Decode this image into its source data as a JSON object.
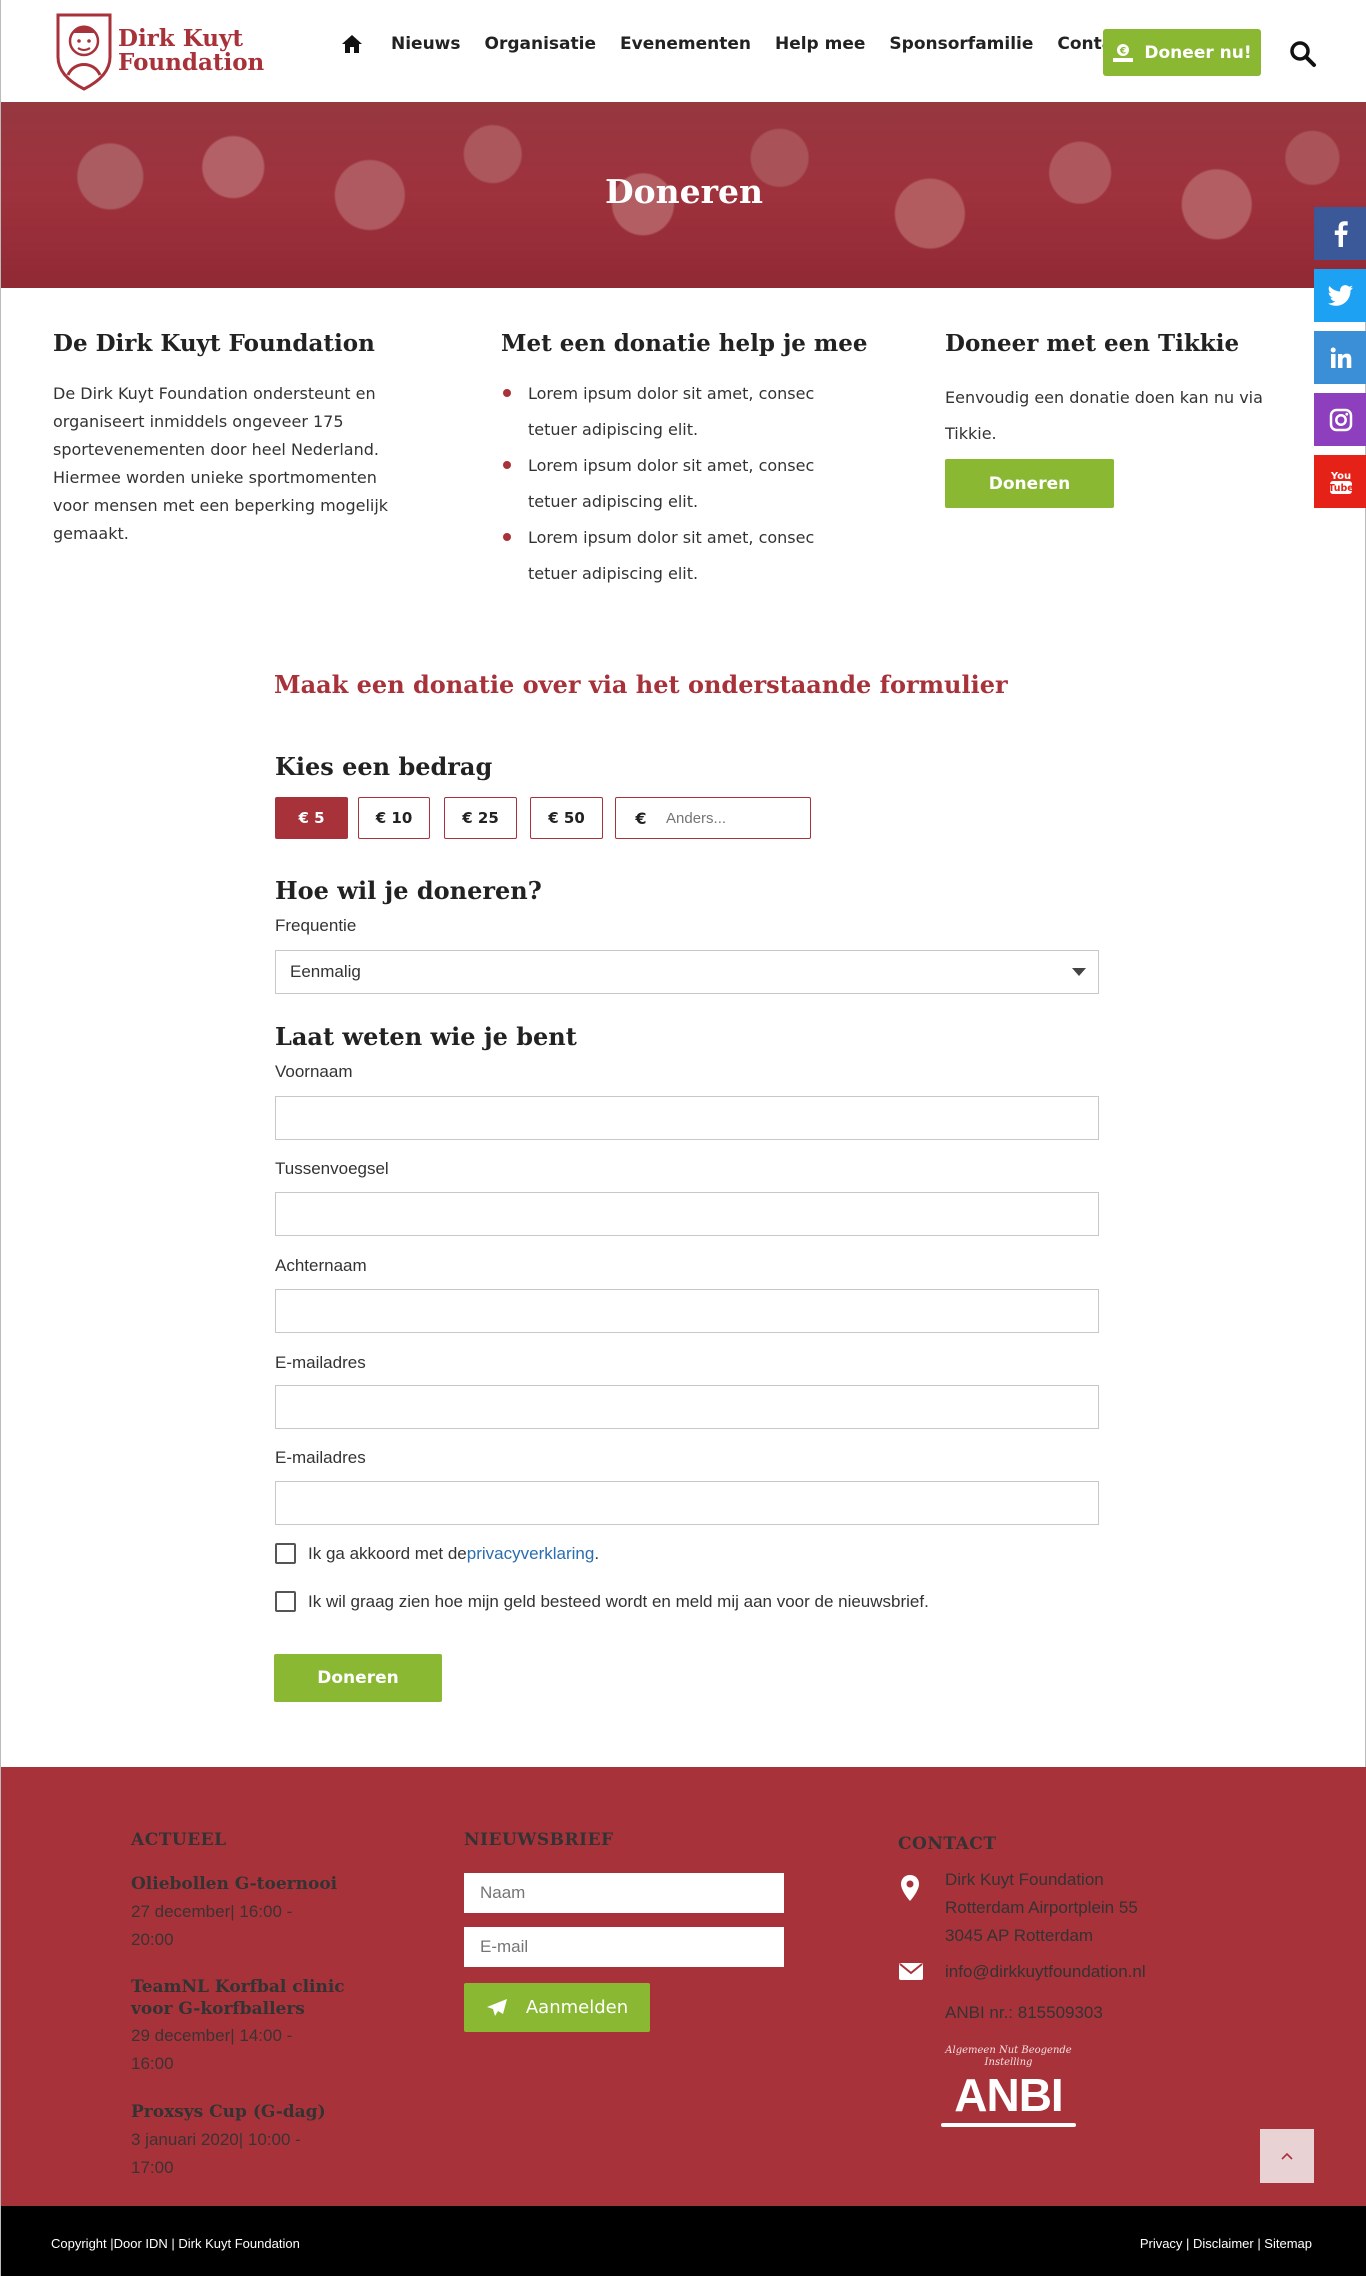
{
  "header": {
    "logo": {
      "line1": "Dirk Kuyt",
      "line2": "Foundation"
    },
    "nav": [
      "Nieuws",
      "Organisatie",
      "Evenementen",
      "Help mee",
      "Sponsorfamilie",
      "Contact"
    ],
    "donate_button": "Doneer nu!"
  },
  "hero": {
    "title": "Doneren"
  },
  "social": [
    "facebook",
    "twitter",
    "linkedin",
    "instagram",
    "youtube"
  ],
  "info": {
    "col1": {
      "title": "De Dirk Kuyt Foundation",
      "text": "De Dirk Kuyt Foundation ondersteunt en organiseert inmiddels ongeveer 175 sportevenementen door heel Nederland. Hiermee worden unieke sportmomenten voor mensen met een beperking mogelijk gemaakt."
    },
    "col2": {
      "title": "Met een donatie help je mee",
      "bullets": [
        "Lorem ipsum dolor sit amet, consec tetuer adipiscing elit.",
        "Lorem ipsum dolor sit amet, consec tetuer adipiscing elit.",
        "Lorem ipsum dolor sit amet, consec tetuer adipiscing elit."
      ]
    },
    "col3": {
      "title": "Doneer met een Tikkie",
      "text": "Eenvoudig een donatie doen kan nu via Tikkie.",
      "button": "Doneren"
    }
  },
  "form": {
    "title": "Maak een donatie over via het onderstaande formulier",
    "amount_heading": "Kies een bedrag",
    "amounts": [
      "€ 5",
      "€ 10",
      "€ 25",
      "€ 50"
    ],
    "selected_amount": "€ 5",
    "other_currency": "€",
    "other_placeholder": "Anders...",
    "how_heading": "Hoe wil je doneren?",
    "frequency_label": "Frequentie",
    "frequency_value": "Eenmalig",
    "who_heading": "Laat weten wie je bent",
    "fields": [
      "Voornaam",
      "Tussenvoegsel",
      "Achternaam",
      "E-mailadres",
      "E-mailadres"
    ],
    "privacy_prefix": "Ik ga akkoord met de ",
    "privacy_link": "privacyverklaring",
    "privacy_suffix": ".",
    "newsletter_check": "Ik wil graag zien hoe mijn geld besteed wordt en meld mij aan voor de nieuwsbrief.",
    "submit": "Doneren"
  },
  "footer": {
    "actueel": {
      "heading": "ACTUEEL",
      "events": [
        {
          "title": "Oliebollen G-toernooi",
          "date": "27 december| 16:00 - 20:00"
        },
        {
          "title": "TeamNL Korfbal clinic voor G-korfballers",
          "date": "29 december| 14:00 - 16:00"
        },
        {
          "title": "Proxsys Cup (G-dag)",
          "date": "3 januari 2020| 10:00 - 17:00"
        }
      ]
    },
    "newsletter": {
      "heading": "NIEUWSBRIEF",
      "name_placeholder": "Naam",
      "email_placeholder": "E-mail",
      "button": "Aanmelden"
    },
    "contact": {
      "heading": "CONTACT",
      "address": [
        "Dirk Kuyt Foundation",
        "Rotterdam Airportplein 55",
        "3045 AP  Rotterdam"
      ],
      "email": "info@dirkkuytfoundation.nl",
      "anbi_nr": "ANBI nr.: 815509303",
      "anbi_top": "Algemeen Nut Beogende Instelling",
      "anbi_logo": "ANBI"
    },
    "copyright": "Copyright |Door IDN | Dirk Kuyt Foundation",
    "links": "Privacy | Disclaimer | Sitemap"
  },
  "colors": {
    "brand_red": "#a8323a",
    "green": "#8ab833",
    "facebook": "#3b5998",
    "twitter": "#1da1f2",
    "linkedin": "#3a8fd6",
    "instagram": "#8e3fbd",
    "youtube": "#e62117"
  }
}
